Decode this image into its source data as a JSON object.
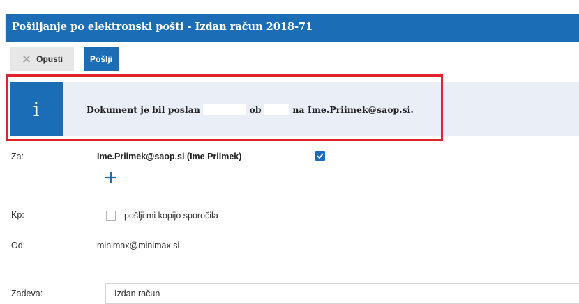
{
  "dialog": {
    "title": "Pošiljanje po elektronski pošti - Izdan račun 2018-71"
  },
  "toolbar": {
    "cancel_label": "Opusti",
    "send_label": "Pošlji"
  },
  "info": {
    "prefix": "Dokument je bil poslan",
    "at_word": "ob",
    "suffix": "na Ime.Priimek@saop.si."
  },
  "form": {
    "to_label": "Za:",
    "to_recipient": "Ime.Priimek@saop.si (Ime Priimek)",
    "to_checked": true,
    "cc_label": "Kp:",
    "cc_copy_label": "pošlji mi kopijo sporočila",
    "cc_checked": false,
    "from_label": "Od:",
    "from_value": "minimax@minimax.si",
    "subject_label": "Zadeva:",
    "subject_value": "Izdan račun"
  },
  "icons": {
    "info": "info-icon",
    "cancel": "close-icon",
    "add": "plus-icon",
    "check": "checkmark-icon"
  },
  "colors": {
    "primary": "#1b6eb5",
    "info_background": "#e9eef7",
    "highlight_frame": "#e0242b"
  }
}
